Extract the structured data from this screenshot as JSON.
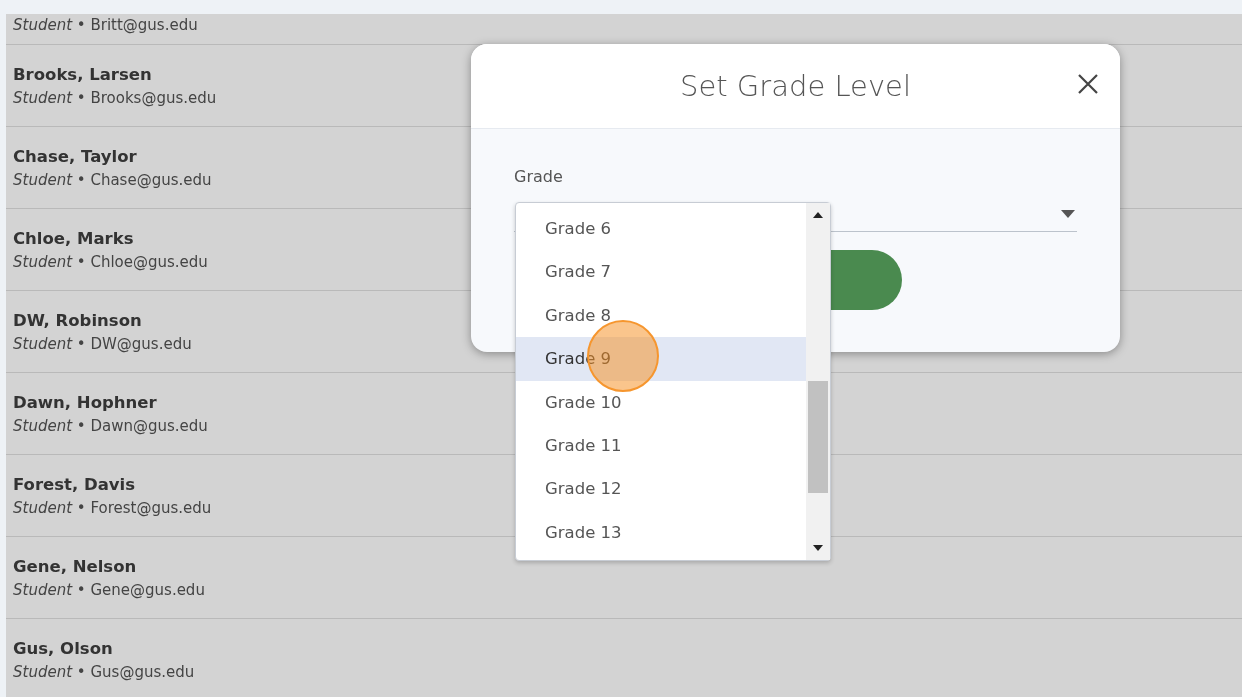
{
  "people": [
    {
      "subtitle": "*Student* • Britt@gus.edu"
    },
    {
      "name": "Brooks, Larsen",
      "subtitle": "*Student* • Brooks@gus.edu"
    },
    {
      "name": "Chase, Taylor",
      "subtitle": "*Student* • Chase@gus.edu"
    },
    {
      "name": "Chloe, Marks",
      "subtitle": "*Student* • Chloe@gus.edu"
    },
    {
      "name": "DW, Robinson",
      "subtitle": "*Student* • DW@gus.edu"
    },
    {
      "name": "Dawn, Hophner",
      "subtitle": "*Student* • Dawn@gus.edu"
    },
    {
      "name": "Forest, Davis",
      "subtitle": "*Student* • Forest@gus.edu"
    },
    {
      "name": "Gene, Nelson",
      "subtitle": "*Student* • Gene@gus.edu"
    },
    {
      "name": "Gus, Olson",
      "subtitle": "*Student* • Gus@gus.edu"
    }
  ],
  "dialog": {
    "title": "Set Grade Level",
    "field_label": "Grade",
    "options": [
      {
        "label": "Grade 6",
        "selected": false
      },
      {
        "label": "Grade 7",
        "selected": false
      },
      {
        "label": "Grade 8",
        "selected": false
      },
      {
        "label": "Grade 9",
        "selected": true
      },
      {
        "label": "Grade 10",
        "selected": false
      },
      {
        "label": "Grade 11",
        "selected": false
      },
      {
        "label": "Grade 12",
        "selected": false
      },
      {
        "label": "Grade 13",
        "selected": false
      }
    ]
  }
}
